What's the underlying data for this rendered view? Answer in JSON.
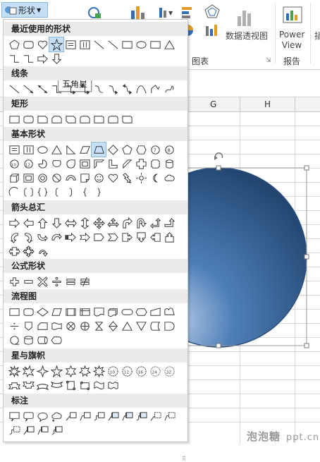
{
  "ribbon": {
    "shapes_button": "形状",
    "pivot_chart": "数据透视图",
    "power_view": "Power View",
    "chart_group": "图表",
    "report_group": "报告",
    "insert_cut": "插"
  },
  "sheet": {
    "columns": [
      "G",
      "H"
    ]
  },
  "dropdown": {
    "categories": [
      {
        "label": "最近使用的形状"
      },
      {
        "label": "线条"
      },
      {
        "label": "矩形"
      },
      {
        "label": "基本形状"
      },
      {
        "label": "箭头总汇"
      },
      {
        "label": "公式形状"
      },
      {
        "label": "流程图"
      },
      {
        "label": "星与旗帜"
      },
      {
        "label": "标注"
      }
    ],
    "tooltip": "五角星"
  },
  "colors": {
    "accent": "#c5e0f6",
    "circle_dark": "#26507f",
    "circle_light": "#6b93c4"
  },
  "watermark": {
    "brand": "泡泡糖",
    "site": "ppt.cn"
  }
}
